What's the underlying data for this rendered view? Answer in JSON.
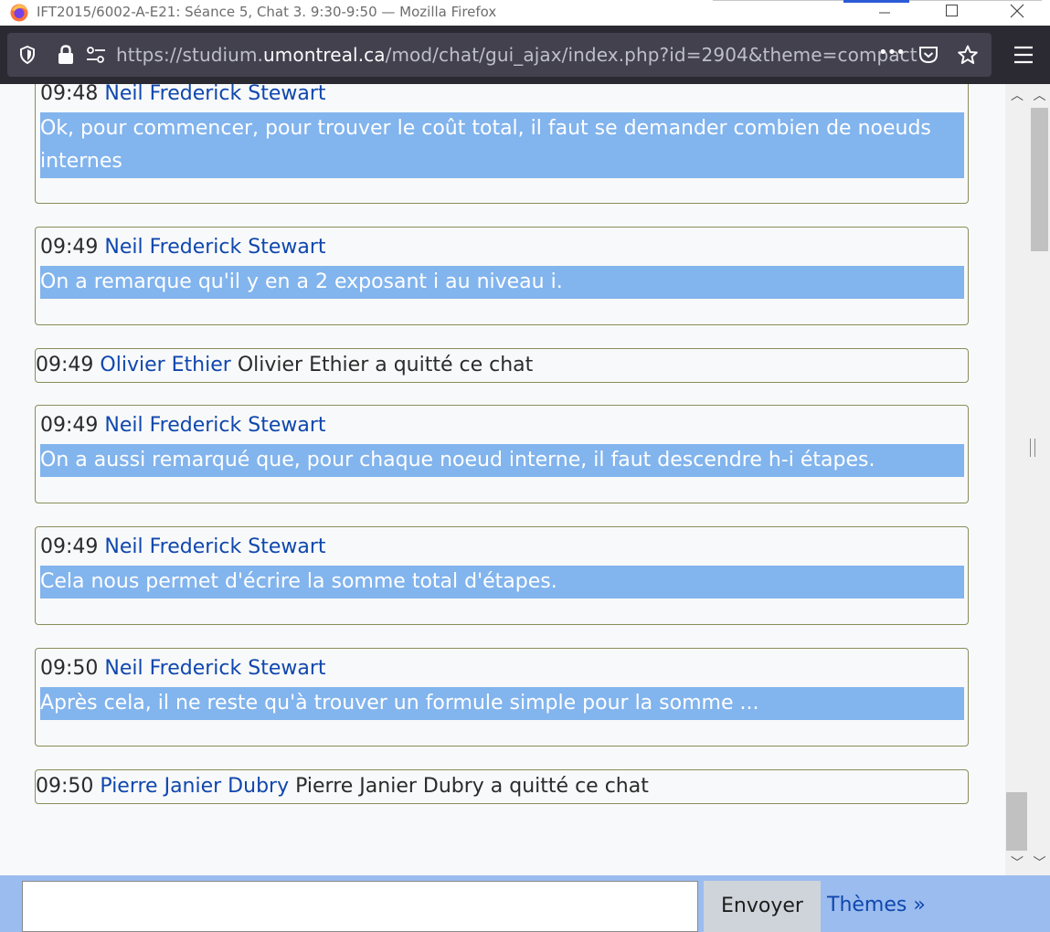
{
  "window": {
    "title": "IFT2015/6002-A-E21: Séance 5, Chat 3. 9:30-9:50 — Mozilla Firefox"
  },
  "toolbar": {
    "url_prefix": "https://studium.",
    "url_domain": "umontreal.ca",
    "url_path": "/mod/chat/gui_ajax/index.php?id=2904&theme=compact",
    "more_label": "•••"
  },
  "messages": [
    {
      "type": "message",
      "time": "09:48",
      "user": "Neil Frederick Stewart",
      "text": "Ok, pour commencer, pour trouver le coût total, il faut se demander combien de noeuds internes"
    },
    {
      "type": "message",
      "time": "09:49",
      "user": "Neil Frederick Stewart",
      "text": "On a remarque qu'il y en a 2 exposant i au niveau i."
    },
    {
      "type": "system",
      "time": "09:49",
      "user": "Olivier Ethier",
      "text": "Olivier Ethier a quitté ce chat"
    },
    {
      "type": "message",
      "time": "09:49",
      "user": "Neil Frederick Stewart",
      "text": "On a aussi remarqué que, pour chaque noeud interne, il faut descendre h-i étapes."
    },
    {
      "type": "message",
      "time": "09:49",
      "user": "Neil Frederick Stewart",
      "text": "Cela nous permet d'écrire la somme total d'étapes."
    },
    {
      "type": "message",
      "time": "09:50",
      "user": "Neil Frederick Stewart",
      "text": "Après cela, il ne reste qu'à trouver un formule simple pour la somme ..."
    },
    {
      "type": "system",
      "time": "09:50",
      "user": "Pierre Janier Dubry",
      "text": "Pierre Janier Dubry a quitté ce chat"
    }
  ],
  "composer": {
    "input_value": "",
    "send_label": "Envoyer",
    "themes_label": "Thèmes »"
  },
  "colors": {
    "message_highlight": "#82b4ed",
    "username": "#0f47ad",
    "composer_bar": "#9bbcef",
    "browser_chrome": "#2b2a33"
  }
}
